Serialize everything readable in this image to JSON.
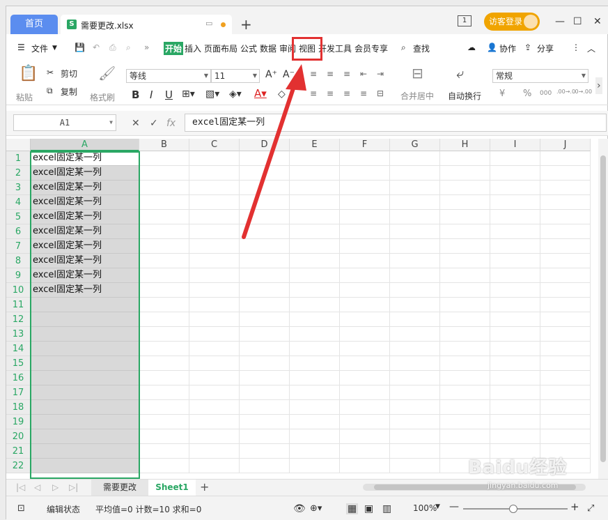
{
  "titlebar": {
    "home_tab": "首页",
    "file_icon_letter": "S",
    "file_name": "需要更改.xlsx",
    "new_tab": "+",
    "count_badge": "1",
    "login_label": "访客登录",
    "minimize": "—",
    "maximize": "☐",
    "close": "✕"
  },
  "menu": {
    "file": "文件",
    "tabs": [
      "开始",
      "插入",
      "页面布局",
      "公式",
      "数据",
      "审阅",
      "视图",
      "开发工具",
      "会员专享"
    ],
    "active_tab": "开始",
    "highlighted_tab": "视图",
    "search": "查找",
    "collab": "协作",
    "share": "分享"
  },
  "ribbon": {
    "paste": "粘贴",
    "cut": "剪切",
    "copy": "复制",
    "format_painter": "格式刷",
    "font_name": "等线",
    "font_size": "11",
    "bold": "B",
    "italic": "I",
    "underline": "U",
    "merge": "合并居中",
    "wrap": "自动换行",
    "number_format": "常规",
    "currency": "¥",
    "percent": "%",
    "thousand": "000",
    "dec_inc": ".00→.0",
    "dec_dec": ".0→.00"
  },
  "formula_bar": {
    "name_box": "A1",
    "fx": "fx",
    "content": "excel固定某一列"
  },
  "grid": {
    "columns": [
      "A",
      "B",
      "C",
      "D",
      "E",
      "F",
      "G",
      "H",
      "I",
      "J"
    ],
    "rows": [
      "1",
      "2",
      "3",
      "4",
      "5",
      "6",
      "7",
      "8",
      "9",
      "10",
      "11",
      "12",
      "13",
      "14",
      "15",
      "16",
      "17",
      "18",
      "19",
      "20",
      "21",
      "22"
    ],
    "column_a_values": [
      "excel固定某一列",
      "excel固定某一列",
      "excel固定某一列",
      "excel固定某一列",
      "excel固定某一列",
      "excel固定某一列",
      "excel固定某一列",
      "excel固定某一列",
      "excel固定某一列",
      "excel固定某一列"
    ]
  },
  "sheets": {
    "tabs": [
      "需要更改",
      "Sheet1"
    ],
    "active": "Sheet1"
  },
  "status": {
    "mode": "编辑状态",
    "stats": "平均值=0  计数=10  求和=0",
    "zoom": "100%"
  },
  "watermark": {
    "brand": "Baidu经验",
    "url": "jingyan.baidu.com"
  },
  "colors": {
    "accent_green": "#2aa764",
    "home_blue": "#5b8def",
    "login_orange": "#f0a400",
    "annotation_red": "#e23131"
  }
}
